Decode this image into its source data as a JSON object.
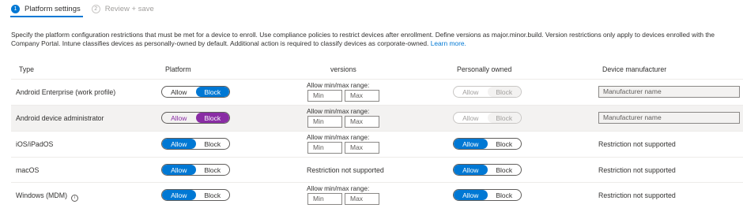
{
  "wizard": {
    "steps": [
      {
        "number": "1",
        "label": "Platform settings"
      },
      {
        "number": "2",
        "label": "Review + save"
      }
    ]
  },
  "description": {
    "text": "Specify the platform configuration restrictions that must be met for a device to enroll. Use compliance policies to restrict devices after enrollment. Define versions as major.minor.build. Version restrictions only apply to devices enrolled with the Company Portal. Intune classifies devices as personally-owned by default. Additional action is required to classify devices as corporate-owned.",
    "link": "Learn more."
  },
  "table": {
    "headers": {
      "type": "Type",
      "platform": "Platform",
      "versions": "versions",
      "personally_owned": "Personally owned",
      "manufacturer": "Device manufacturer"
    },
    "toggle_labels": {
      "allow": "Allow",
      "block": "Block"
    },
    "version_range_label": "Allow min/max range:",
    "min_placeholder": "Min",
    "max_placeholder": "Max",
    "manufacturer_placeholder": "Manufacturer name",
    "restriction_not_supported": "Restriction not supported",
    "rows": [
      {
        "type": "Android Enterprise (work profile)",
        "platform": "Block",
        "personally_owned": "Block",
        "personally_owned_disabled": true,
        "manufacturer_input": true,
        "versions_supported": true
      },
      {
        "type": "Android device administrator",
        "platform": "Block",
        "personally_owned": "Allow",
        "personally_owned_disabled": true,
        "manufacturer_input": true,
        "versions_supported": true
      },
      {
        "type": "iOS/iPadOS",
        "platform": "Allow",
        "personally_owned": "Allow",
        "personally_owned_disabled": false,
        "manufacturer_input": false,
        "versions_supported": true
      },
      {
        "type": "macOS",
        "platform": "Allow",
        "personally_owned": "Allow",
        "personally_owned_disabled": false,
        "manufacturer_input": false,
        "versions_supported": false
      },
      {
        "type": "Windows (MDM)",
        "platform": "Allow",
        "personally_owned": "Allow",
        "personally_owned_disabled": false,
        "manufacturer_input": false,
        "versions_supported": true,
        "info_icon": true
      }
    ]
  },
  "colors": {
    "accent": "#0078d4",
    "selected_row_accent": "#8a2da5"
  }
}
